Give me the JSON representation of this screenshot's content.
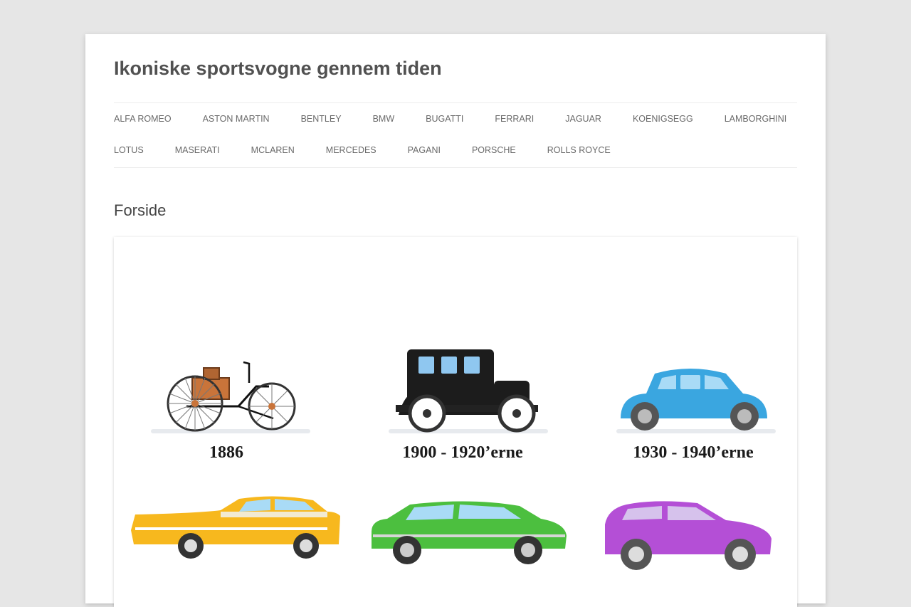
{
  "site": {
    "title": "Ikoniske sportsvogne gennem tiden"
  },
  "nav": {
    "row1": [
      "ALFA ROMEO",
      "ASTON MARTIN",
      "BENTLEY",
      "BMW",
      "BUGATTI",
      "FERRARI",
      "JAGUAR",
      "KOENIGSEGG",
      "LAMBORGHINI"
    ],
    "row2": [
      "LOTUS",
      "MASERATI",
      "MCLAREN",
      "MERCEDES",
      "PAGANI",
      "PORSCHE",
      "ROLLS ROYCE"
    ]
  },
  "page": {
    "heading": "Forside"
  },
  "featured_image": {
    "labels": [
      "1886",
      "1900 - 1920’erne",
      "1930 - 1940’erne"
    ],
    "car_colors": {
      "era_1886": "#c9743a",
      "era_1900": "#1c1c1c",
      "era_1930": "#3aa6e0",
      "era_1950": "#f7b81e",
      "era_1980": "#4cbf3f",
      "era_2000": "#b44fd6"
    }
  },
  "colors": {
    "background": "#e6e6e6",
    "page": "#ffffff",
    "title": "#515151",
    "nav_text": "#6a6a6a"
  }
}
